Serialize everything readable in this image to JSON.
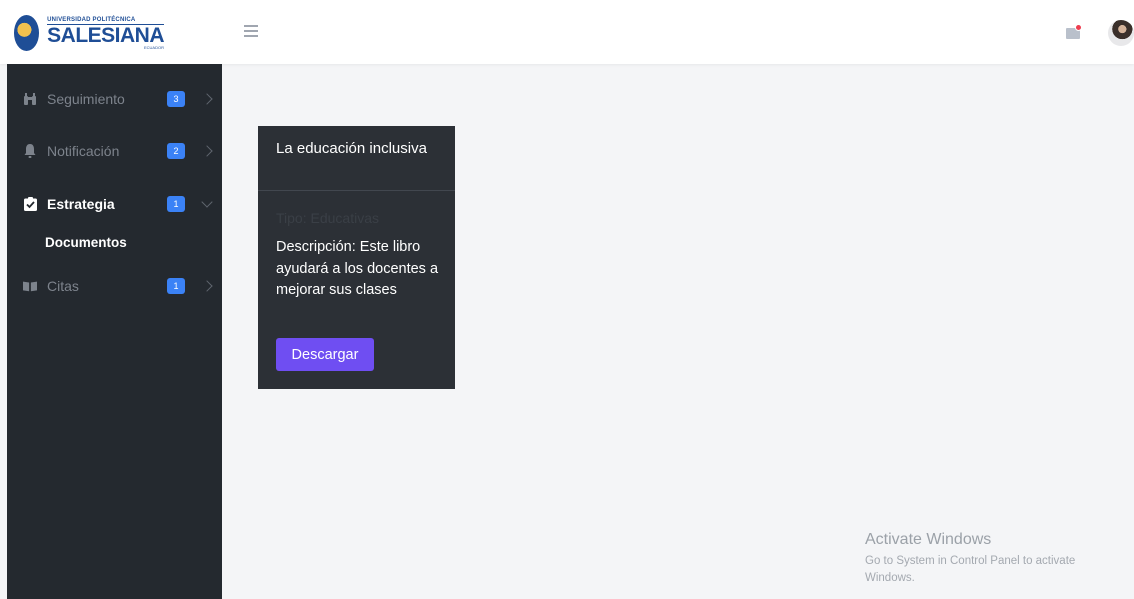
{
  "header": {
    "logo_top": "UNIVERSIDAD POLITÉCNICA",
    "logo_name": "SALESIANA",
    "logo_country": "ECUADOR"
  },
  "sidebar": {
    "items": [
      {
        "label": "Seguimiento",
        "badge": "3",
        "icon": "binoculars-icon"
      },
      {
        "label": "Notificación",
        "badge": "2",
        "icon": "bell-icon"
      },
      {
        "label": "Estrategia",
        "badge": "1",
        "icon": "clipboard-check-icon"
      },
      {
        "label": "Citas",
        "badge": "1",
        "icon": "book-icon"
      }
    ],
    "submenu_label": "Documentos"
  },
  "card": {
    "title": "La educación inclusiva",
    "type": "Tipo: Educativas",
    "description": "Descripción: Este libro ayudará a los docentes a mejorar sus clases",
    "button_label": "Descargar"
  },
  "watermark": {
    "title": "Activate Windows",
    "subtitle": "Go to System in Control Panel to activate Windows."
  },
  "colors": {
    "sidebar_bg": "#24292f",
    "card_bg": "#2c3036",
    "badge": "#3b82f6",
    "button": "#6f4ef2",
    "page_bg": "#f4f5f7"
  }
}
